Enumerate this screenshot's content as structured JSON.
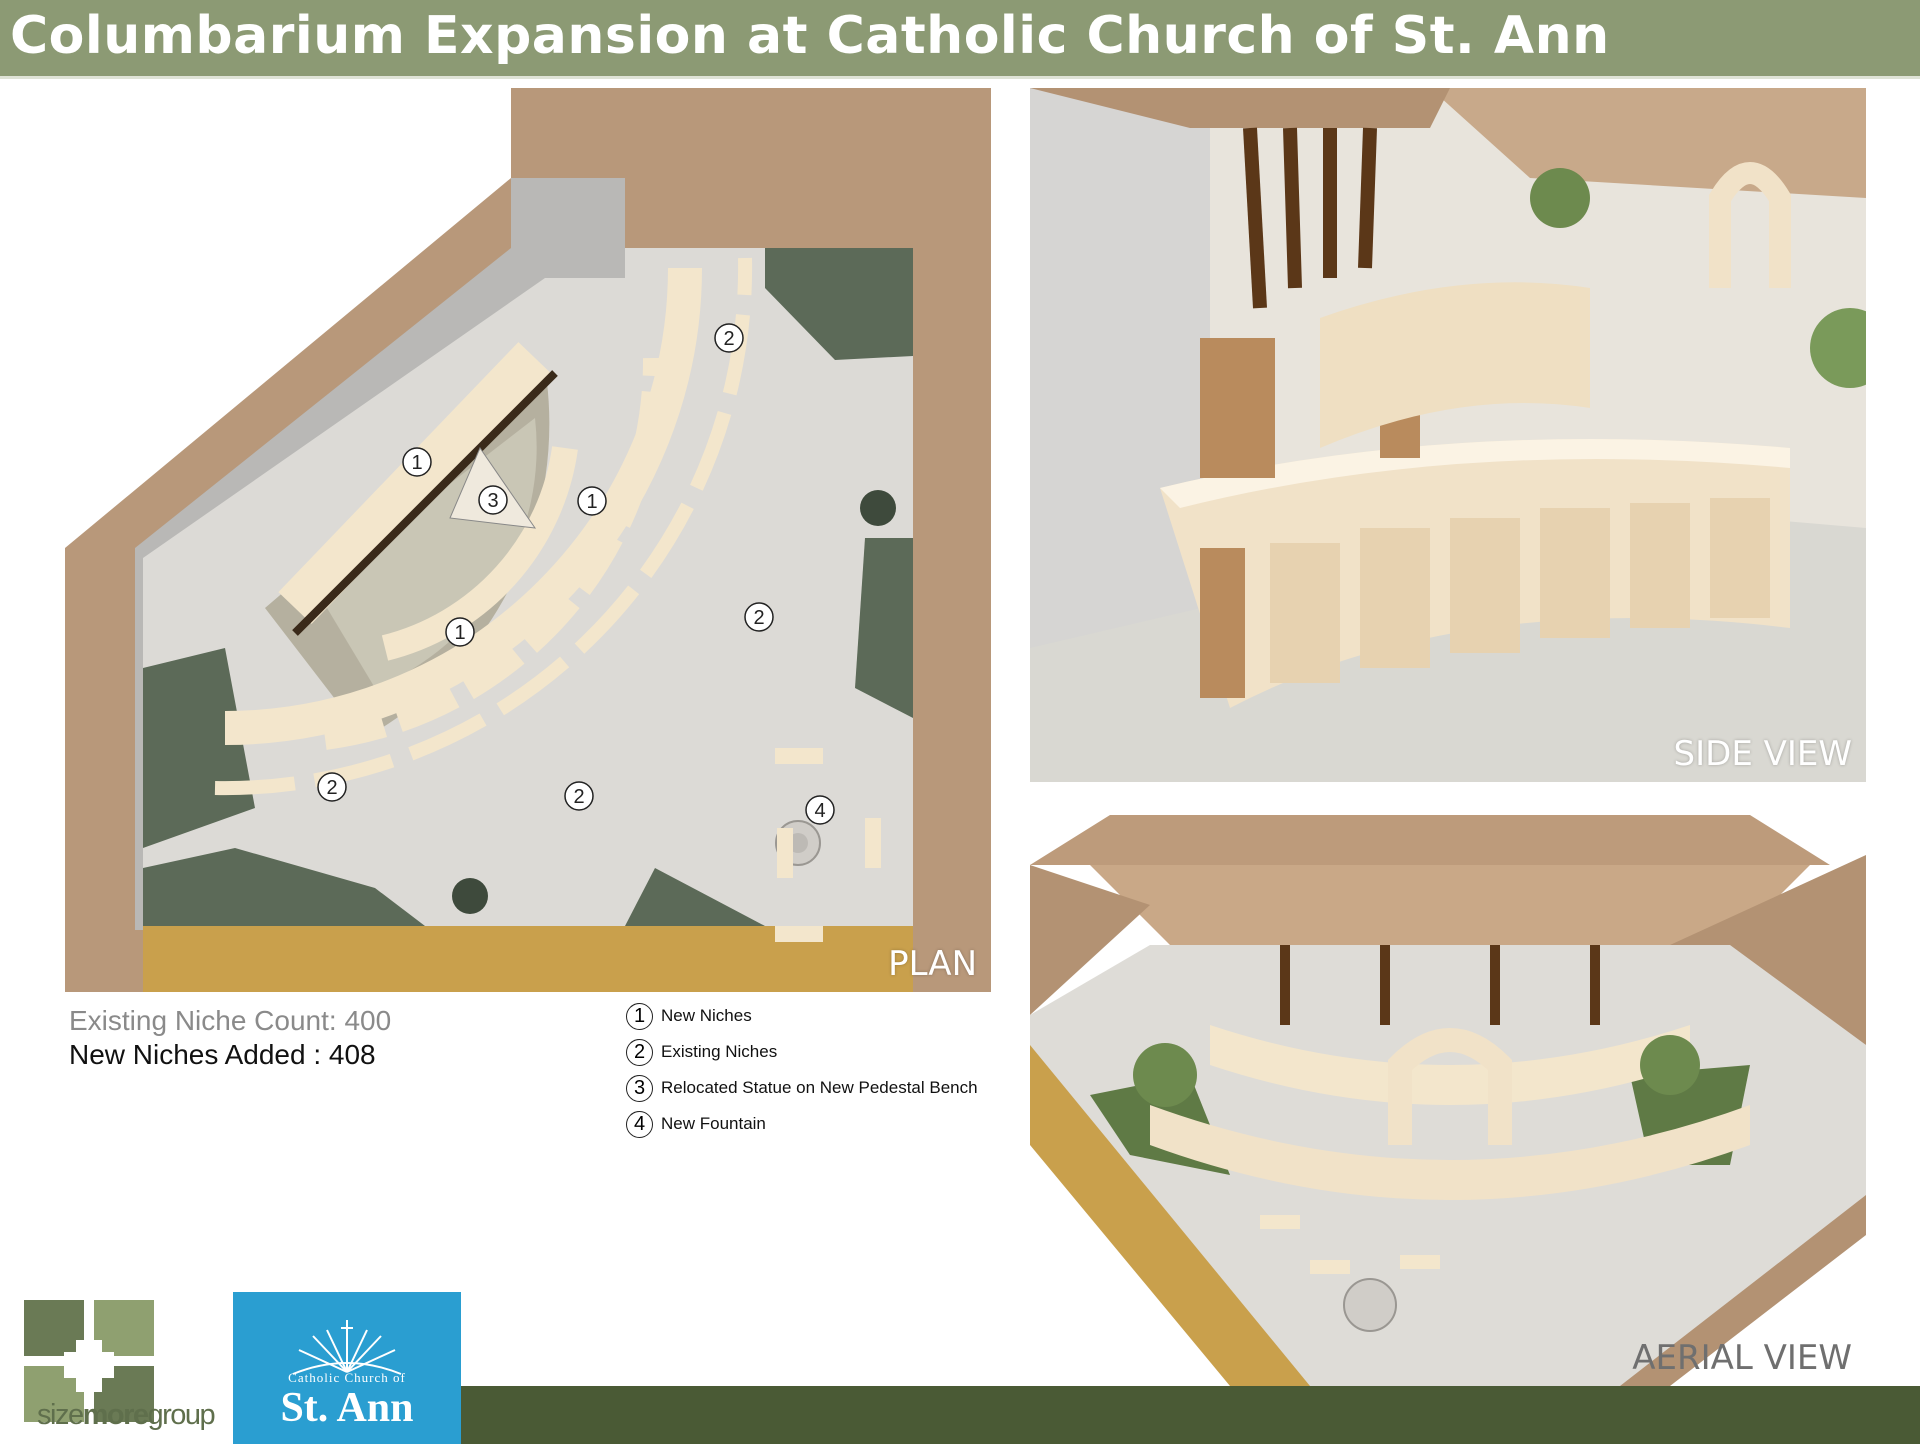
{
  "header": {
    "title": "Columbarium Expansion at Catholic Church of St. Ann"
  },
  "views": {
    "plan_label": "PLAN",
    "side_label": "SIDE VIEW",
    "aerial_label": "AERIAL VIEW"
  },
  "plan_markers": [
    "1",
    "1",
    "1",
    "2",
    "2",
    "2",
    "2",
    "3",
    "4"
  ],
  "counts": {
    "existing": "Existing Niche Count: 400",
    "added": "New Niches Added : 408"
  },
  "legend": [
    {
      "num": "1",
      "label": "New Niches"
    },
    {
      "num": "2",
      "label": "Existing Niches"
    },
    {
      "num": "3",
      "label": "Relocated Statue on New Pedestal Bench"
    },
    {
      "num": "4",
      "label": "New Fountain"
    }
  ],
  "logos": {
    "sizemore_part1": "size",
    "sizemore_part2": "more",
    "sizemore_part3": "group",
    "stann_sub": "Catholic Church of",
    "stann_main": "St. Ann"
  },
  "colors": {
    "title_bar": "#8c9a74",
    "footer_bar": "#4a5a35",
    "roof_tan": "#b8987a",
    "paving": "#d9d7d2",
    "lawn": "#5c6a58",
    "gold_edge": "#c9a04c",
    "niche_cream": "#f3e6cc",
    "stann_blue": "#2a9ed1"
  }
}
